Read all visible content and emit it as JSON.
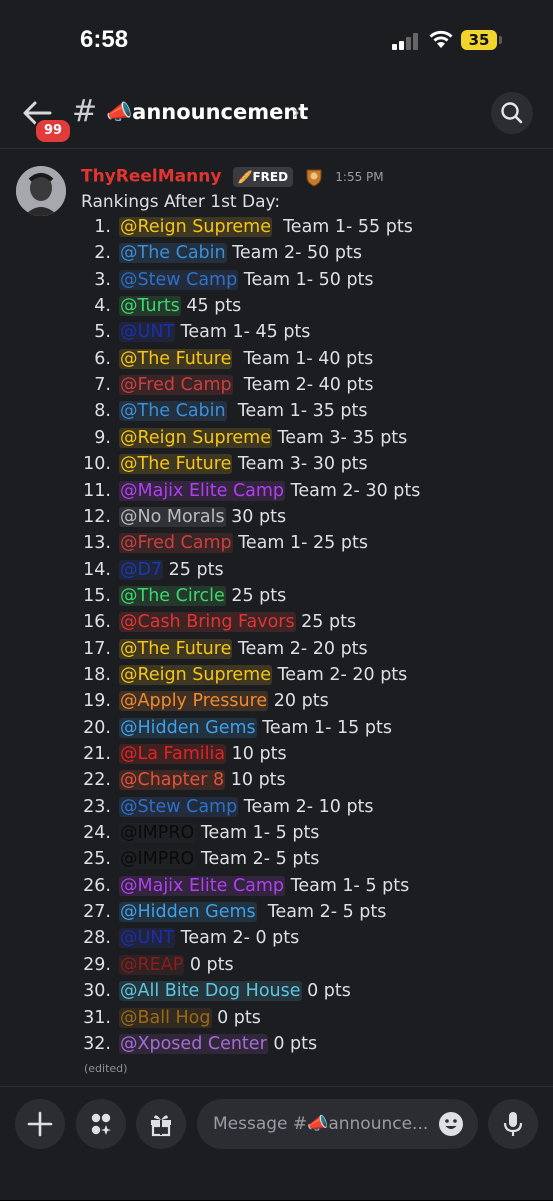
{
  "status_bar": {
    "time": "6:58",
    "battery": "35"
  },
  "header": {
    "unread_badge": "99",
    "channel_prefix": "#",
    "channel_name": "📣announcement",
    "chevron": "›"
  },
  "message": {
    "author": "ThyReelManny",
    "tag": "🥖FRED",
    "timestamp": "1:55 PM",
    "intro": "Rankings After 1st Day:",
    "edited": "(edited)",
    "rankings": [
      {
        "n": "1.",
        "mention": "@Reign Supreme",
        "rest": "  Team 1- 55 pts",
        "color": "#f5c518",
        "bg": "#3e3822"
      },
      {
        "n": "2.",
        "mention": "@The Cabin",
        "rest": " Team 2- 50 pts",
        "color": "#3b8ed8",
        "bg": "#23303f"
      },
      {
        "n": "3.",
        "mention": "@Stew Camp",
        "rest": " Team 1- 50 pts",
        "color": "#2f70c9",
        "bg": "#222c3c"
      },
      {
        "n": "4.",
        "mention": "@Turts",
        "rest": " 45 pts",
        "color": "#3fd66f",
        "bg": "#24392c"
      },
      {
        "n": "5.",
        "mention": "@UNT",
        "rest": " Team 1- 45 pts",
        "color": "#1c2fa8",
        "bg": "#20243a"
      },
      {
        "n": "6.",
        "mention": "@The Future",
        "rest": "  Team 1- 40 pts",
        "color": "#f5c518",
        "bg": "#3e3822"
      },
      {
        "n": "7.",
        "mention": "@Fred Camp",
        "rest": "  Team 2- 40 pts",
        "color": "#c9403f",
        "bg": "#3a2526"
      },
      {
        "n": "8.",
        "mention": "@The Cabin",
        "rest": "  Team 1- 35 pts",
        "color": "#3b8ed8",
        "bg": "#23303f"
      },
      {
        "n": "9.",
        "mention": "@Reign Supreme",
        "rest": " Team 3- 35 pts",
        "color": "#f5c518",
        "bg": "#3e3822"
      },
      {
        "n": "10.",
        "mention": "@The Future",
        "rest": " Team 3- 30 pts",
        "color": "#f5c518",
        "bg": "#3e3822"
      },
      {
        "n": "11.",
        "mention": "@Majix Elite Camp",
        "rest": " Team 2- 30 pts",
        "color": "#b13ef0",
        "bg": "#34253f"
      },
      {
        "n": "12.",
        "mention": "@No Morals",
        "rest": " 30 pts",
        "color": "#b9bcc2",
        "bg": "#303236"
      },
      {
        "n": "13.",
        "mention": "@Fred Camp",
        "rest": " Team 1- 25 pts",
        "color": "#c9403f",
        "bg": "#3a2526"
      },
      {
        "n": "14.",
        "mention": "@D7",
        "rest": " 25 pts",
        "color": "#1c3aa8",
        "bg": "#20253a"
      },
      {
        "n": "15.",
        "mention": "@The Circle",
        "rest": " 25 pts",
        "color": "#3fd66f",
        "bg": "#24392c"
      },
      {
        "n": "16.",
        "mention": "@Cash Bring Favors",
        "rest": " 25 pts",
        "color": "#e33434",
        "bg": "#3e2424"
      },
      {
        "n": "17.",
        "mention": "@The Future",
        "rest": " Team 2- 20 pts",
        "color": "#f5c518",
        "bg": "#3e3822"
      },
      {
        "n": "18.",
        "mention": "@Reign Supreme",
        "rest": " Team 2- 20 pts",
        "color": "#f5c518",
        "bg": "#3e3822"
      },
      {
        "n": "19.",
        "mention": "@Apply Pressure",
        "rest": " 20 pts",
        "color": "#f0892e",
        "bg": "#3e3024"
      },
      {
        "n": "20.",
        "mention": "@Hidden Gems",
        "rest": " Team 1- 15 pts",
        "color": "#3fa0e8",
        "bg": "#23323f"
      },
      {
        "n": "21.",
        "mention": "@La Familia",
        "rest": " 10 pts",
        "color": "#e32222",
        "bg": "#3e2222"
      },
      {
        "n": "22.",
        "mention": "@Chapter 8",
        "rest": " 10 pts",
        "color": "#e4533a",
        "bg": "#3d2824"
      },
      {
        "n": "23.",
        "mention": "@Stew Camp",
        "rest": " Team 2- 10 pts",
        "color": "#2f70c9",
        "bg": "#222c3c"
      },
      {
        "n": "24.",
        "mention": "@IMPRO",
        "rest": " Team 1- 5 pts",
        "color": "#0a0a0a",
        "bg": "#1f2024"
      },
      {
        "n": "25.",
        "mention": "@IMPRO",
        "rest": " Team 2- 5 pts",
        "color": "#0a0a0a",
        "bg": "#1f2024"
      },
      {
        "n": "26.",
        "mention": "@Majix Elite Camp",
        "rest": " Team 1- 5 pts",
        "color": "#b13ef0",
        "bg": "#34253f"
      },
      {
        "n": "27.",
        "mention": "@Hidden Gems",
        "rest": "  Team 2- 5 pts",
        "color": "#3fa0e8",
        "bg": "#23323f"
      },
      {
        "n": "28.",
        "mention": "@UNT",
        "rest": " Team 2- 0 pts",
        "color": "#1c2fa8",
        "bg": "#20243a"
      },
      {
        "n": "29.",
        "mention": "@REAP",
        "rest": " 0 pts",
        "color": "#8b1d1d",
        "bg": "#2e2223"
      },
      {
        "n": "30.",
        "mention": "@All Bite Dog House",
        "rest": " 0 pts",
        "color": "#5cc6e0",
        "bg": "#26353c"
      },
      {
        "n": "31.",
        "mention": "@Ball Hog",
        "rest": " 0 pts",
        "color": "#9c6a14",
        "bg": "#302a20"
      },
      {
        "n": "32.",
        "mention": "@Xposed Center",
        "rest": " 0 pts",
        "color": "#a56bd6",
        "bg": "#302839"
      }
    ]
  },
  "composer": {
    "placeholder": "Message #📣announce..."
  },
  "icons": {
    "back": "back-arrow-icon",
    "search": "search-icon",
    "plus": "plus-icon",
    "apps": "apps-icon",
    "gift": "gift-icon",
    "emoji": "emoji-icon",
    "mic": "microphone-icon"
  }
}
